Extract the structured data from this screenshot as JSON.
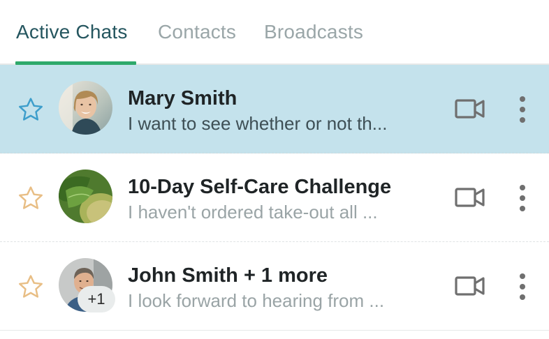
{
  "tabs": {
    "active_chats": "Active Chats",
    "contacts": "Contacts",
    "broadcasts": "Broadcasts",
    "selected": "Active Chats"
  },
  "colors": {
    "tab_accent": "#2fa96b",
    "selected_row": "#c4e2ec",
    "star_selected": "#3d9ecb",
    "star_default": "#e8be85",
    "icon_gray": "#6f6f6f"
  },
  "chats": [
    {
      "name": "Mary Smith",
      "preview": "I want to see whether or not th...",
      "starred_icon": "star-outline-icon",
      "selected": true
    },
    {
      "name": "10-Day Self-Care Challenge",
      "preview": "I haven't ordered take-out all ...",
      "starred_icon": "star-outline-icon",
      "selected": false
    },
    {
      "name": "John Smith + 1 more",
      "preview": "I look forward to hearing from ...",
      "starred_icon": "star-outline-icon",
      "selected": false,
      "extra_participants": "+1"
    }
  ],
  "icons": {
    "video": "video-camera-icon",
    "more": "more-vertical-icon"
  }
}
